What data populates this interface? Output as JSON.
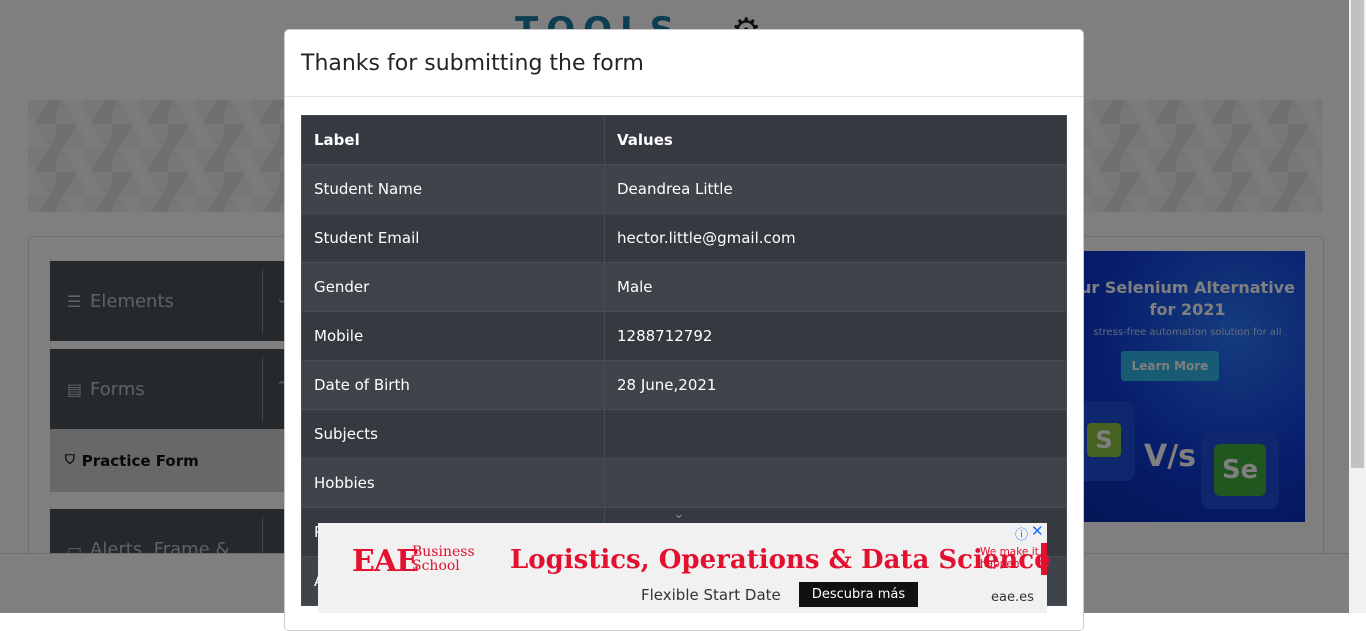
{
  "logo": {
    "text": "TOOLS"
  },
  "sidebar": {
    "groups": [
      {
        "label": "Elements",
        "icon": "hamburger-icon"
      },
      {
        "label": "Forms",
        "icon": "document-icon"
      },
      {
        "label": "Alerts, Frame &",
        "icon": "window-icon"
      }
    ],
    "active_item": {
      "label": "Practice Form",
      "icon": "shield-icon"
    }
  },
  "right_ad": {
    "title": "ur Selenium Alternative for 2021",
    "subtitle": "stress-free automation solution for all",
    "button": "Learn More",
    "badge_left": "S",
    "vs": "V/s",
    "badge_right": "Se"
  },
  "modal": {
    "title": "Thanks for submitting the form",
    "table": {
      "headers": [
        "Label",
        "Values"
      ],
      "rows": [
        {
          "label": "Student Name",
          "value": "Deandrea Little"
        },
        {
          "label": "Student Email",
          "value": "hector.little@gmail.com"
        },
        {
          "label": "Gender",
          "value": "Male"
        },
        {
          "label": "Mobile",
          "value": "1288712792"
        },
        {
          "label": "Date of Birth",
          "value": "28 June,2021"
        },
        {
          "label": "Subjects",
          "value": ""
        },
        {
          "label": "Hobbies",
          "value": ""
        },
        {
          "label": "P",
          "value": ""
        },
        {
          "label": "A",
          "value": ""
        }
      ]
    }
  },
  "bottom_ad": {
    "brand": "EAE",
    "brand_sub_line1": "Business",
    "brand_sub_line2": "School",
    "headline": "Logistics, Operations & Data Science",
    "tagline": "We make it happen",
    "subline": "Flexible Start Date",
    "cta": "Descubra más",
    "domain": "eae.es",
    "adchoices_icon": "info-icon",
    "close_icon": "close-icon"
  },
  "colors": {
    "table_dark": "#343a40",
    "table_row_alt": "#3e444a",
    "sidebar_header": "#4c5258",
    "ad_red": "#e3102f",
    "ad_blue": "#0f3bd6"
  }
}
